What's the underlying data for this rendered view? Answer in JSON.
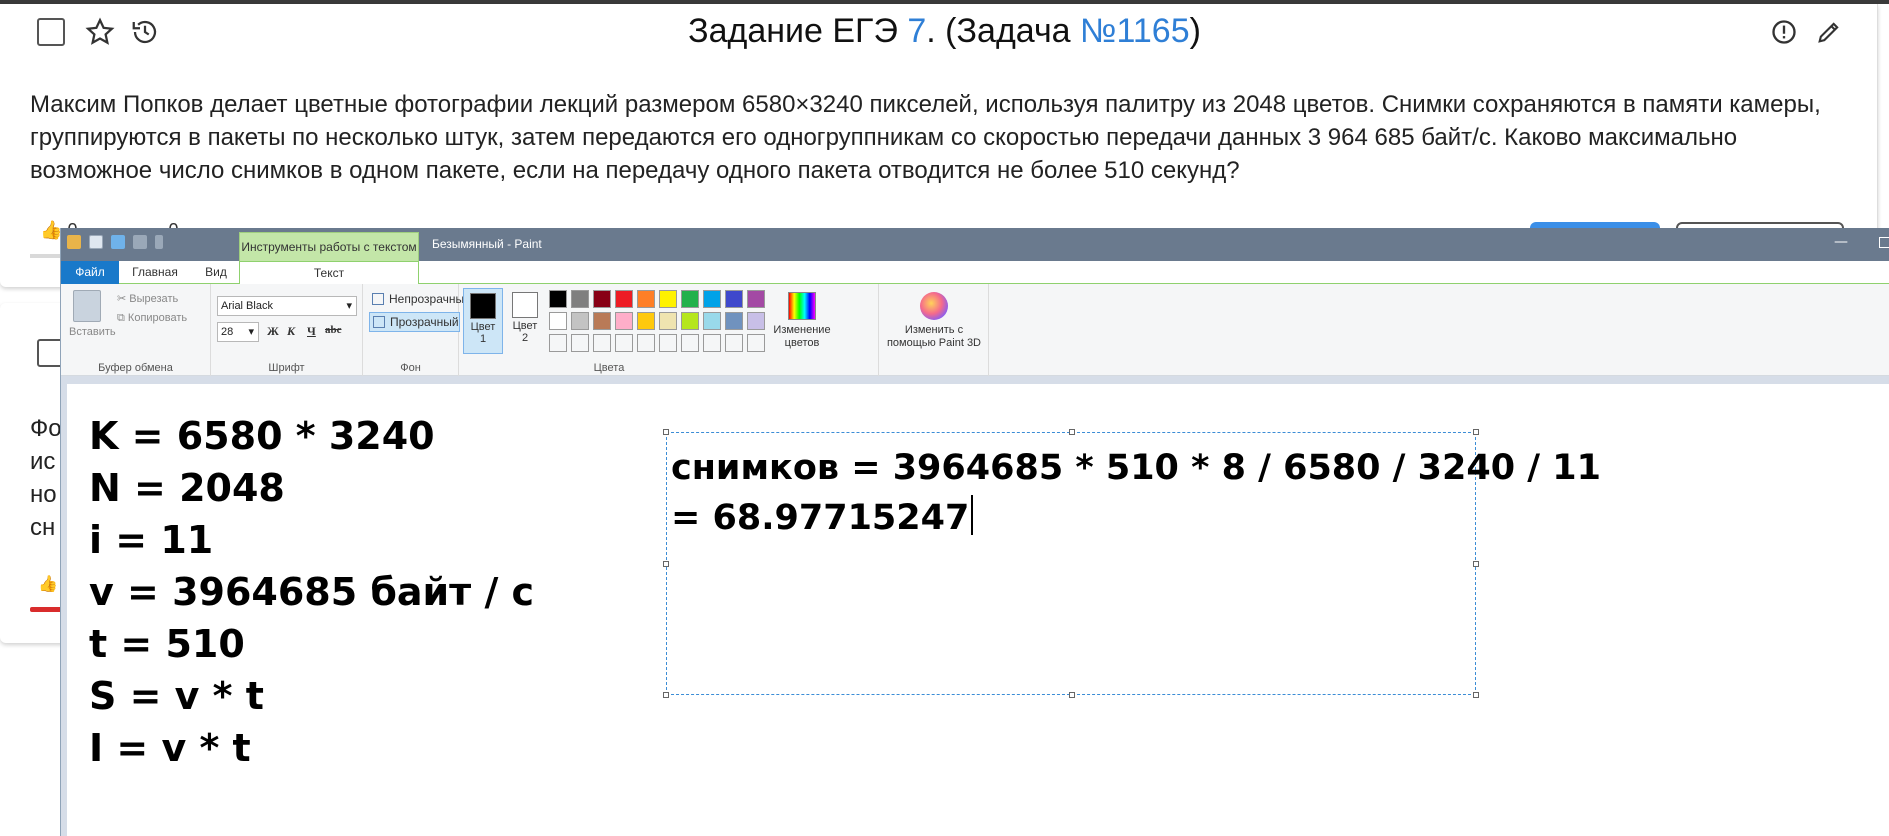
{
  "task": {
    "title_prefix": "Задание ЕГЭ ",
    "title_number": "7",
    "title_middle": ". (Задача ",
    "title_task_id": "№1165",
    "title_suffix": ")",
    "text": "Максим Попков делает цветные фотографии лекций размером 6580×3240 пикселей, используя палитру из 2048 цветов. Снимки сохраняются в памяти камеры, группируются в пакеты по несколько штук, затем передаются его одногруппникам со скоростью передачи данных 3 964 685 байт/с. Каково максимально возможное число снимков в одном пакете, если на передачу одного пакета отводится не более 510 секунд?",
    "likes": "0",
    "dislikes": "0"
  },
  "card2": {
    "text_lines": [
      "Фо",
      "ис",
      "но",
      "сн"
    ]
  },
  "paint": {
    "context_tab": "Инструменты работы с текстом",
    "window_title": "Безымянный - Paint",
    "tabs": {
      "file": "Файл",
      "home": "Главная",
      "view": "Вид",
      "text": "Текст"
    },
    "clipboard": {
      "paste": "Вставить",
      "cut": "Вырезать",
      "copy": "Копировать",
      "label": "Буфер обмена"
    },
    "font": {
      "family": "Arial Black",
      "size": "28",
      "bold": "Ж",
      "italic": "К",
      "underline": "Ч",
      "strike": "abc",
      "label": "Шрифт"
    },
    "background": {
      "opaque": "Непрозрачный",
      "transparent": "Прозрачный",
      "label": "Фон"
    },
    "colors": {
      "color1_line1": "Цвет",
      "color1_line2": "1",
      "color2_line1": "Цвет",
      "color2_line2": "2",
      "label": "Цвета",
      "edit_line1": "Изменение",
      "edit_line2": "цветов",
      "paint3d_line1": "Изменить с",
      "paint3d_line2": "помощью Paint 3D",
      "color1_value": "#000000",
      "color2_value": "#ffffff",
      "palette": [
        "#000000",
        "#7f7f7f",
        "#880015",
        "#ed1c24",
        "#ff7f27",
        "#fff200",
        "#22b14c",
        "#00a2e8",
        "#3f48cc",
        "#a349a4",
        "#ffffff",
        "#c3c3c3",
        "#b97a57",
        "#ffaec9",
        "#ffc90e",
        "#efe4b0",
        "#b5e61d",
        "#99d9ea",
        "#7092be",
        "#c8bfe7",
        "#f5f6f7",
        "#f5f6f7",
        "#f5f6f7",
        "#f5f6f7",
        "#f5f6f7",
        "#f5f6f7",
        "#f5f6f7",
        "#f5f6f7",
        "#f5f6f7",
        "#f5f6f7"
      ]
    },
    "canvas": {
      "formulas": [
        "K = 6580 * 3240",
        "N = 2048",
        "i = 11",
        "v = 3964685 байт / с",
        "t = 510",
        "S = v * t",
        "I = v * t"
      ],
      "textbox_line1": "снимков = 3964685 * 510 * 8 / 6580 / 3240 / 11",
      "textbox_line2": "= 68.97715247"
    }
  }
}
